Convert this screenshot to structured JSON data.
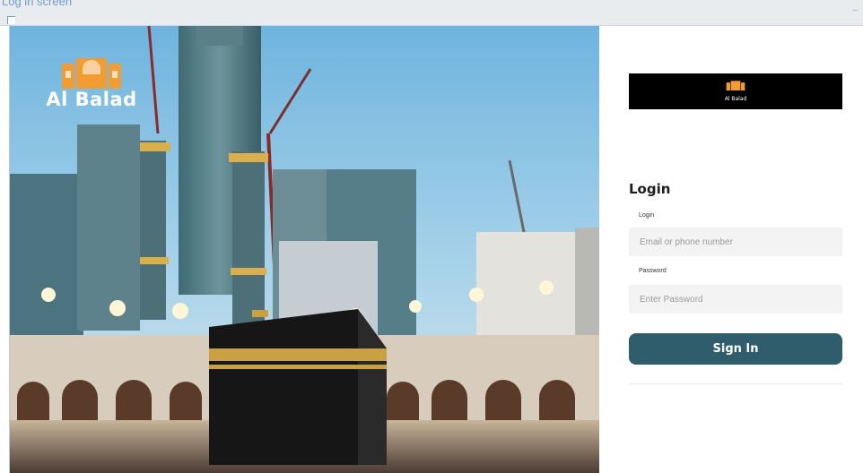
{
  "window": {
    "caption": "Log in screen"
  },
  "hero": {
    "logo_text": "Al Balad",
    "logo_icon": "building-logo-icon"
  },
  "brand": {
    "logo_text": "Al Balad"
  },
  "login": {
    "title": "Login",
    "login_label": "Login",
    "login_placeholder": "Email or phone number",
    "password_label": "Password",
    "password_placeholder": "Enter Password",
    "submit_label": "Sign In"
  },
  "colors": {
    "primary_button": "#2f5d6c",
    "brand_bar": "#000000",
    "logo_orange": "#f39c32"
  }
}
